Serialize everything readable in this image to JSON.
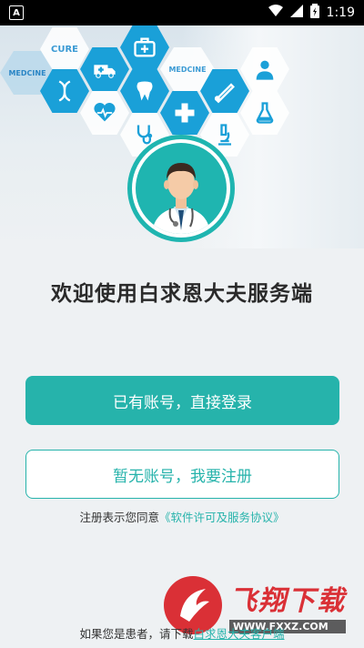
{
  "status_bar": {
    "app_indicator": "A",
    "time": "1:19",
    "icons": [
      "wifi-icon",
      "signal-icon",
      "battery-icon"
    ]
  },
  "hero": {
    "labels": [
      "CURE",
      "MEDCINE",
      "MEDCINE"
    ],
    "icons": [
      "first-aid-kit-icon",
      "ambulance-icon",
      "dna-icon",
      "heart-pulse-icon",
      "tooth-icon",
      "medical-cross-icon",
      "thermometer-icon",
      "doctor-icon",
      "stethoscope-icon",
      "microscope-icon",
      "flask-icon"
    ]
  },
  "welcome_title": "欢迎使用白求恩大夫服务端",
  "buttons": {
    "login": "已有账号，直接登录",
    "register": "暂无账号，我要注册"
  },
  "agreement": {
    "prefix": "注册表示您同意",
    "link": "《软件许可及服务协议》"
  },
  "footer": {
    "prefix": "如果您是患者，请下载",
    "link": "白求恩大夫客户端"
  },
  "watermark": {
    "title": "飞翔下载",
    "subtitle": "WWW.FXXZ.COM"
  },
  "colors": {
    "accent": "#26b3ab",
    "hex_blue": "#1aa0d8",
    "status_bar": "#000000"
  }
}
